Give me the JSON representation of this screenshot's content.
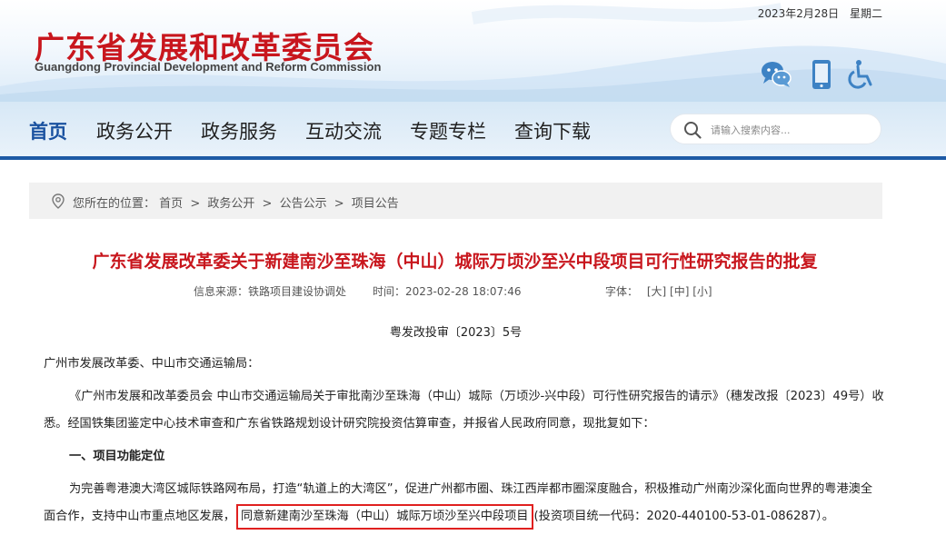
{
  "header": {
    "date": "2023年2月28日",
    "weekday": "星期二",
    "logo_cn": "广东省发展和改革委员会",
    "logo_en": "Guangdong Provincial Development and Reform Commission",
    "icons": [
      "wechat-icon",
      "mobile-icon",
      "accessibility-icon"
    ],
    "brand_color": "#c8161d",
    "accent_color": "#1d5aa5"
  },
  "nav": {
    "items": [
      {
        "label": "首页",
        "active": true
      },
      {
        "label": "政务公开"
      },
      {
        "label": "政务服务"
      },
      {
        "label": "互动交流"
      },
      {
        "label": "专题专栏"
      },
      {
        "label": "查询下载"
      }
    ],
    "search_placeholder": "请输入搜索内容..."
  },
  "breadcrumb": {
    "prefix": "您所在的位置：",
    "items": [
      "首页",
      "政务公开",
      "公告公示",
      "项目公告"
    ],
    "separator": ">"
  },
  "article": {
    "title": "广东省发展改革委关于新建南沙至珠海（中山）城际万顷沙至兴中段项目可行性研究报告的批复",
    "source_label": "信息来源：",
    "source": "铁路项目建设协调处",
    "time_label": "时间：",
    "time": "2023-02-28 18:07:46",
    "font_label": "字体：",
    "font_sizes": [
      "[大]",
      "[中]",
      "[小]"
    ],
    "doc_number": "粤发改投审〔2023〕5号",
    "addressee": "广州市发展改革委、中山市交通运输局：",
    "p1_line1": "《广州市发展和改革委员会 中山市交通运输局关于审批南沙至珠海（中山）城际（万顷沙-兴中段）可行性研究报告的请示》（穗发改报〔2023〕49号）收",
    "p1_line2": "悉。经国铁集团鉴定中心技术审查和广东省铁路规划设计研究院投资估算审查，并报省人民政府同意，现批复如下：",
    "section1_heading": "一、项目功能定位",
    "p2_line1": "为完善粤港澳大湾区城际铁路网布局，打造“轨道上的大湾区”，促进广州都市圈、珠江西岸都市圈深度融合，积极推动广州南沙深化面向世界的粤港澳全",
    "p2_line2_a": "面合作，支持中山市重点地区发展，",
    "p2_line2_highlight": "同意新建南沙至珠海（中山）城际万顷沙至兴中段项目",
    "p2_line2_b": "(投资项目统一代码：2020-440100-53-01-086287）。",
    "highlight_color": "#e0201f"
  }
}
